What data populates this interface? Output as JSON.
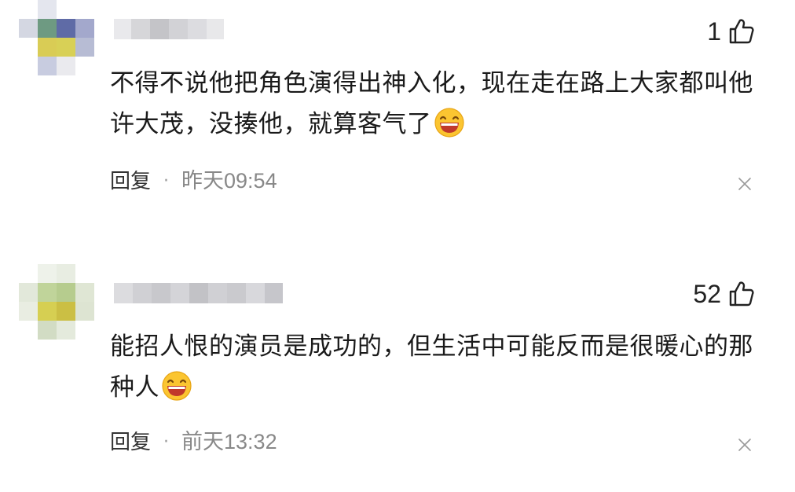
{
  "comments": [
    {
      "like_count": "1",
      "text": "不得不说他把角色演得出神入化，现在走在路上大家都叫他许大茂，没揍他，就算客气了",
      "reply_label": "回复",
      "separator": "·",
      "time": "昨天09:54",
      "avatar_colors": [
        "#c8ccd8",
        "#7a9a86",
        "#5e6ea8",
        "#9aa0c8",
        "#d7c85a",
        "#d9d050",
        "#a8b4c8",
        "#e6e6ea"
      ]
    },
    {
      "like_count": "52",
      "text": "能招人恨的演员是成功的，但生活中可能反而是很暖心的那种人",
      "reply_label": "回复",
      "separator": "·",
      "time": "前天13:32",
      "avatar_colors": [
        "#dde5d6",
        "#b8d092",
        "#c8dab0",
        "#e2df62",
        "#c8c040",
        "#cfd8c0",
        "#e6ece0",
        "#f0f3ea"
      ]
    }
  ],
  "icons": {
    "like": "thumbs-up-icon",
    "emoji": "laughing-emoji-icon",
    "close": "close-icon"
  }
}
